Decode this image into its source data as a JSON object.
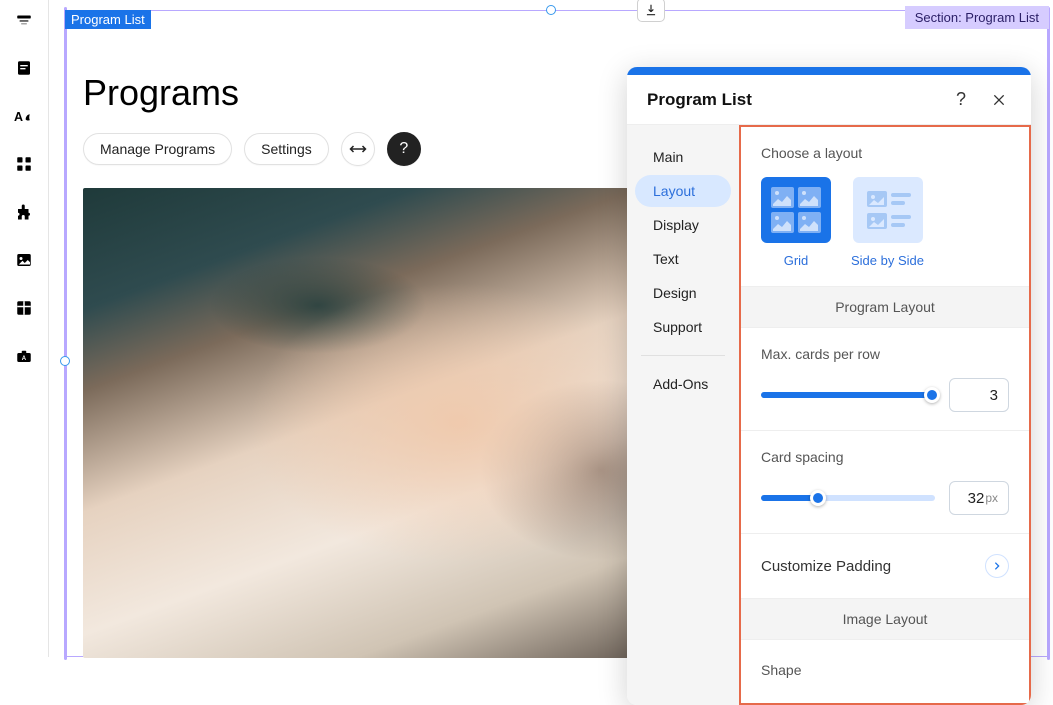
{
  "section_label": "Section: Program List",
  "plist_badge": "Program List",
  "page_title": "Programs",
  "toolbar": {
    "manage": "Manage Programs",
    "settings": "Settings"
  },
  "panel": {
    "title": "Program List",
    "nav": {
      "main": "Main",
      "layout": "Layout",
      "display": "Display",
      "text": "Text",
      "design": "Design",
      "support": "Support",
      "addons": "Add-Ons"
    },
    "content": {
      "choose_layout": "Choose a layout",
      "grid": "Grid",
      "side_by_side": "Side by Side",
      "program_layout": "Program Layout",
      "max_cards": "Max. cards per row",
      "max_cards_value": "3",
      "card_spacing": "Card spacing",
      "card_spacing_value": "32",
      "card_spacing_unit": "px",
      "customize_padding": "Customize Padding",
      "image_layout": "Image Layout",
      "shape": "Shape"
    },
    "sliders": {
      "max_cards_fill": "98",
      "card_spacing_fill": "33"
    }
  }
}
